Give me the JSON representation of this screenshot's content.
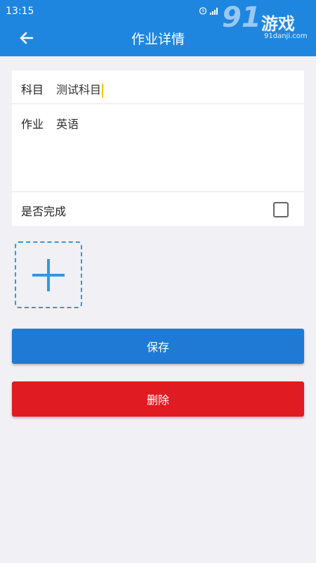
{
  "status_bar": {
    "time": "13:15"
  },
  "watermark": {
    "logo_number": "91",
    "logo_text": "游戏",
    "url": "91danji.com"
  },
  "app_bar": {
    "title": "作业详情",
    "back_icon": "arrow-left-icon"
  },
  "form": {
    "subject_label": "科目",
    "subject_value": "测试科目",
    "homework_label": "作业",
    "homework_value": "英语",
    "completed_label": "是否完成",
    "completed_checked": false
  },
  "photo": {
    "add_icon": "plus-icon"
  },
  "actions": {
    "save_label": "保存",
    "delete_label": "删除"
  },
  "colors": {
    "primary": "#1f86e0",
    "save": "#1f7ad6",
    "delete": "#e01b22",
    "background": "#f0f0f5",
    "caret": "#f5c400"
  }
}
